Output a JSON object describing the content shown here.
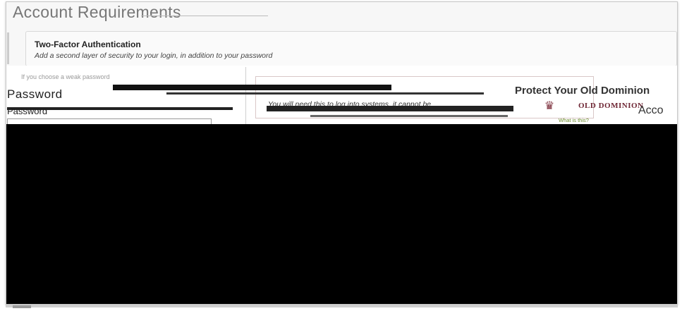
{
  "page": {
    "title": "Account Requirements"
  },
  "two_factor": {
    "title": "Two-Factor Authentication",
    "description": "Add a second layer of security to your login, in addition to your password"
  },
  "password_section": {
    "heading": "Password",
    "label": "Password",
    "helper": "If you choose a weak password"
  },
  "notice": {
    "text": "You will need this to log into systems, it cannot be"
  },
  "protect": {
    "heading": "Protect Your Old Dominion"
  },
  "logo": {
    "text": "OLD DOMINION",
    "tagline": "What is this?"
  },
  "account": {
    "label": "Acco"
  }
}
